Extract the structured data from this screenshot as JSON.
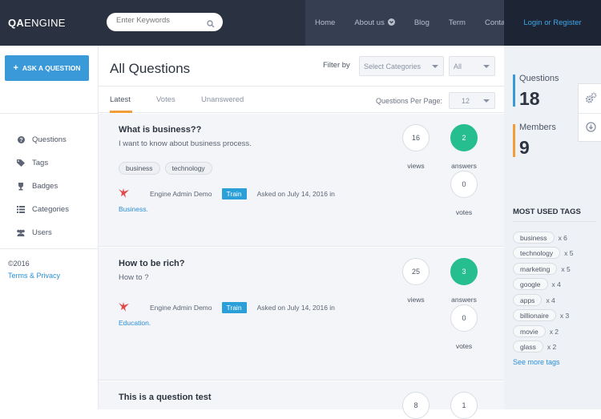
{
  "brand": {
    "bold": "QA",
    "rest": "ENGINE"
  },
  "search": {
    "placeholder": "Enter Keywords"
  },
  "nav": {
    "items": [
      {
        "label": "Home"
      },
      {
        "label": "About us"
      },
      {
        "label": "Blog"
      },
      {
        "label": "Term"
      },
      {
        "label": "Contact"
      }
    ],
    "login": "Login or Register"
  },
  "sidebar": {
    "ask_button": "ASK A QUESTION",
    "menu": [
      {
        "label": "Questions",
        "icon": "question-circle-icon"
      },
      {
        "label": "Tags",
        "icon": "tags-icon"
      },
      {
        "label": "Badges",
        "icon": "trophy-icon"
      },
      {
        "label": "Categories",
        "icon": "list-icon"
      },
      {
        "label": "Users",
        "icon": "users-icon"
      }
    ],
    "copyright": "©2016",
    "terms": "Terms & Privacy"
  },
  "main": {
    "title": "All Questions",
    "filter_label": "Filter by",
    "category_select": "Select Categories",
    "all_select": "All",
    "tabs": [
      {
        "label": "Latest",
        "active": true
      },
      {
        "label": "Votes",
        "active": false
      },
      {
        "label": "Unanswered",
        "active": false
      }
    ],
    "per_page_label": "Questions Per Page:",
    "per_page_value": "12",
    "questions": [
      {
        "title": "What is business??",
        "desc": "I want to know about business process.",
        "tags": [
          "business",
          "technology"
        ],
        "author": "Engine Admin Demo",
        "badge": "Train",
        "asked": "Asked on July 14, 2016 in",
        "category": "Business.",
        "views": "16",
        "answers": "2",
        "votes": "0"
      },
      {
        "title": "How to be rich?",
        "desc": "How to ?",
        "tags": [],
        "author": "Engine Admin Demo",
        "badge": "Train",
        "asked": "Asked on July 14, 2016 in",
        "category": "Education.",
        "views": "25",
        "answers": "3",
        "votes": "0"
      },
      {
        "title": "This is a question test",
        "desc": "",
        "tags": [],
        "author": "",
        "badge": "",
        "asked": "",
        "category": "",
        "views": "8",
        "answers": "1",
        "votes": ""
      }
    ],
    "labels": {
      "views": "views",
      "answers": "answers",
      "votes": "votes"
    }
  },
  "right": {
    "stats": [
      {
        "label": "Questions",
        "value": "18",
        "color": "#3a9ad9"
      },
      {
        "label": "Members",
        "value": "9",
        "color": "#f29d38"
      }
    ],
    "tags_title": "MOST USED TAGS",
    "tags": [
      {
        "name": "business",
        "count": "x 6"
      },
      {
        "name": "technology",
        "count": "x 5"
      },
      {
        "name": "marketing",
        "count": "x 5"
      },
      {
        "name": "google",
        "count": "x 4"
      },
      {
        "name": "apps",
        "count": "x 4"
      },
      {
        "name": "billionaire",
        "count": "x 3"
      },
      {
        "name": "movie",
        "count": "x 2"
      },
      {
        "name": "glass",
        "count": "x 2"
      }
    ],
    "see_more": "See more tags"
  }
}
